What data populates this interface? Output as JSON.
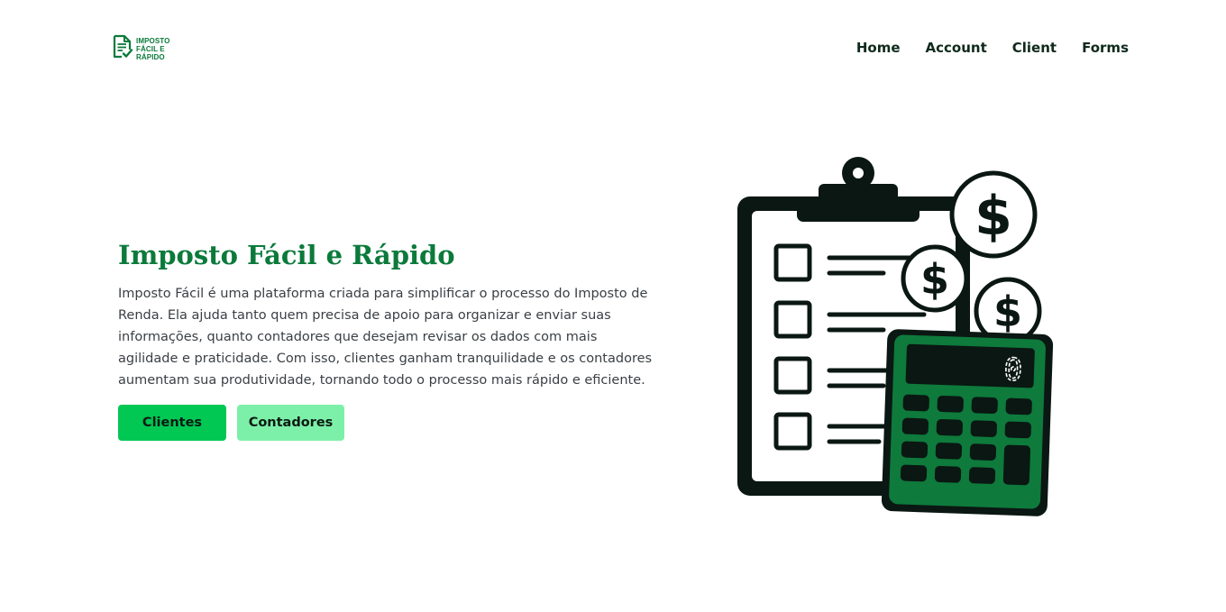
{
  "header": {
    "logo": {
      "lines": [
        "IMPOSTO",
        "FÁCIL E",
        "RÁPIDO"
      ],
      "icon": "document-check-icon"
    },
    "nav": [
      {
        "label": "Home"
      },
      {
        "label": "Account"
      },
      {
        "label": "Client"
      },
      {
        "label": "Forms"
      }
    ]
  },
  "hero": {
    "title": "Imposto Fácil e Rápido",
    "description": "Imposto Fácil é uma plataforma criada para simplificar o processo do Imposto de Renda. Ela ajuda tanto quem precisa de apoio para organizar e enviar suas informações, quanto contadores que desejam revisar os dados com mais agilidade e praticidade. Com isso, clientes ganham tranquilidade e os contadores aumentam sua produtividade, tornando todo o processo mais rápido e eficiente.",
    "buttons": {
      "clientes": "Clientes",
      "contadores": "Contadores"
    }
  },
  "illustration": {
    "icon": "clipboard-calculator-coins-icon",
    "calculator_display": "0",
    "coin_symbol": "$"
  },
  "colors": {
    "brand_green": "#0b7a3b",
    "button_primary": "#00c853",
    "button_secondary": "#7cf0a8",
    "calculator_green": "#0e7a3c",
    "outline_dark": "#0a1712"
  }
}
